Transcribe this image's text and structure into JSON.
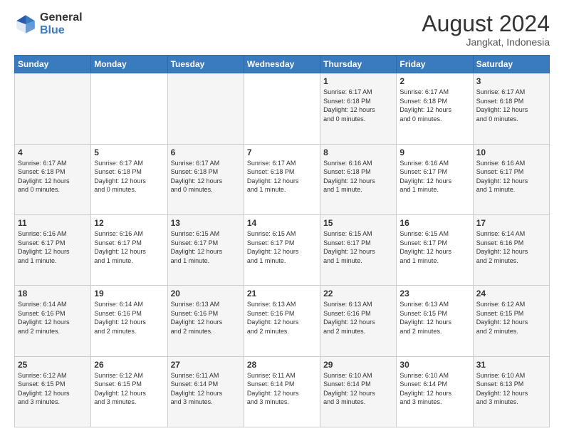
{
  "header": {
    "logo_line1": "General",
    "logo_line2": "Blue",
    "main_title": "August 2024",
    "subtitle": "Jangkat, Indonesia"
  },
  "calendar": {
    "days_of_week": [
      "Sunday",
      "Monday",
      "Tuesday",
      "Wednesday",
      "Thursday",
      "Friday",
      "Saturday"
    ],
    "weeks": [
      [
        {
          "day": "",
          "info": ""
        },
        {
          "day": "",
          "info": ""
        },
        {
          "day": "",
          "info": ""
        },
        {
          "day": "",
          "info": ""
        },
        {
          "day": "1",
          "info": "Sunrise: 6:17 AM\nSunset: 6:18 PM\nDaylight: 12 hours\nand 0 minutes."
        },
        {
          "day": "2",
          "info": "Sunrise: 6:17 AM\nSunset: 6:18 PM\nDaylight: 12 hours\nand 0 minutes."
        },
        {
          "day": "3",
          "info": "Sunrise: 6:17 AM\nSunset: 6:18 PM\nDaylight: 12 hours\nand 0 minutes."
        }
      ],
      [
        {
          "day": "4",
          "info": "Sunrise: 6:17 AM\nSunset: 6:18 PM\nDaylight: 12 hours\nand 0 minutes."
        },
        {
          "day": "5",
          "info": "Sunrise: 6:17 AM\nSunset: 6:18 PM\nDaylight: 12 hours\nand 0 minutes."
        },
        {
          "day": "6",
          "info": "Sunrise: 6:17 AM\nSunset: 6:18 PM\nDaylight: 12 hours\nand 0 minutes."
        },
        {
          "day": "7",
          "info": "Sunrise: 6:17 AM\nSunset: 6:18 PM\nDaylight: 12 hours\nand 1 minute."
        },
        {
          "day": "8",
          "info": "Sunrise: 6:16 AM\nSunset: 6:18 PM\nDaylight: 12 hours\nand 1 minute."
        },
        {
          "day": "9",
          "info": "Sunrise: 6:16 AM\nSunset: 6:17 PM\nDaylight: 12 hours\nand 1 minute."
        },
        {
          "day": "10",
          "info": "Sunrise: 6:16 AM\nSunset: 6:17 PM\nDaylight: 12 hours\nand 1 minute."
        }
      ],
      [
        {
          "day": "11",
          "info": "Sunrise: 6:16 AM\nSunset: 6:17 PM\nDaylight: 12 hours\nand 1 minute."
        },
        {
          "day": "12",
          "info": "Sunrise: 6:16 AM\nSunset: 6:17 PM\nDaylight: 12 hours\nand 1 minute."
        },
        {
          "day": "13",
          "info": "Sunrise: 6:15 AM\nSunset: 6:17 PM\nDaylight: 12 hours\nand 1 minute."
        },
        {
          "day": "14",
          "info": "Sunrise: 6:15 AM\nSunset: 6:17 PM\nDaylight: 12 hours\nand 1 minute."
        },
        {
          "day": "15",
          "info": "Sunrise: 6:15 AM\nSunset: 6:17 PM\nDaylight: 12 hours\nand 1 minute."
        },
        {
          "day": "16",
          "info": "Sunrise: 6:15 AM\nSunset: 6:17 PM\nDaylight: 12 hours\nand 1 minute."
        },
        {
          "day": "17",
          "info": "Sunrise: 6:14 AM\nSunset: 6:16 PM\nDaylight: 12 hours\nand 2 minutes."
        }
      ],
      [
        {
          "day": "18",
          "info": "Sunrise: 6:14 AM\nSunset: 6:16 PM\nDaylight: 12 hours\nand 2 minutes."
        },
        {
          "day": "19",
          "info": "Sunrise: 6:14 AM\nSunset: 6:16 PM\nDaylight: 12 hours\nand 2 minutes."
        },
        {
          "day": "20",
          "info": "Sunrise: 6:13 AM\nSunset: 6:16 PM\nDaylight: 12 hours\nand 2 minutes."
        },
        {
          "day": "21",
          "info": "Sunrise: 6:13 AM\nSunset: 6:16 PM\nDaylight: 12 hours\nand 2 minutes."
        },
        {
          "day": "22",
          "info": "Sunrise: 6:13 AM\nSunset: 6:16 PM\nDaylight: 12 hours\nand 2 minutes."
        },
        {
          "day": "23",
          "info": "Sunrise: 6:13 AM\nSunset: 6:15 PM\nDaylight: 12 hours\nand 2 minutes."
        },
        {
          "day": "24",
          "info": "Sunrise: 6:12 AM\nSunset: 6:15 PM\nDaylight: 12 hours\nand 2 minutes."
        }
      ],
      [
        {
          "day": "25",
          "info": "Sunrise: 6:12 AM\nSunset: 6:15 PM\nDaylight: 12 hours\nand 3 minutes."
        },
        {
          "day": "26",
          "info": "Sunrise: 6:12 AM\nSunset: 6:15 PM\nDaylight: 12 hours\nand 3 minutes."
        },
        {
          "day": "27",
          "info": "Sunrise: 6:11 AM\nSunset: 6:14 PM\nDaylight: 12 hours\nand 3 minutes."
        },
        {
          "day": "28",
          "info": "Sunrise: 6:11 AM\nSunset: 6:14 PM\nDaylight: 12 hours\nand 3 minutes."
        },
        {
          "day": "29",
          "info": "Sunrise: 6:10 AM\nSunset: 6:14 PM\nDaylight: 12 hours\nand 3 minutes."
        },
        {
          "day": "30",
          "info": "Sunrise: 6:10 AM\nSunset: 6:14 PM\nDaylight: 12 hours\nand 3 minutes."
        },
        {
          "day": "31",
          "info": "Sunrise: 6:10 AM\nSunset: 6:13 PM\nDaylight: 12 hours\nand 3 minutes."
        }
      ]
    ]
  }
}
